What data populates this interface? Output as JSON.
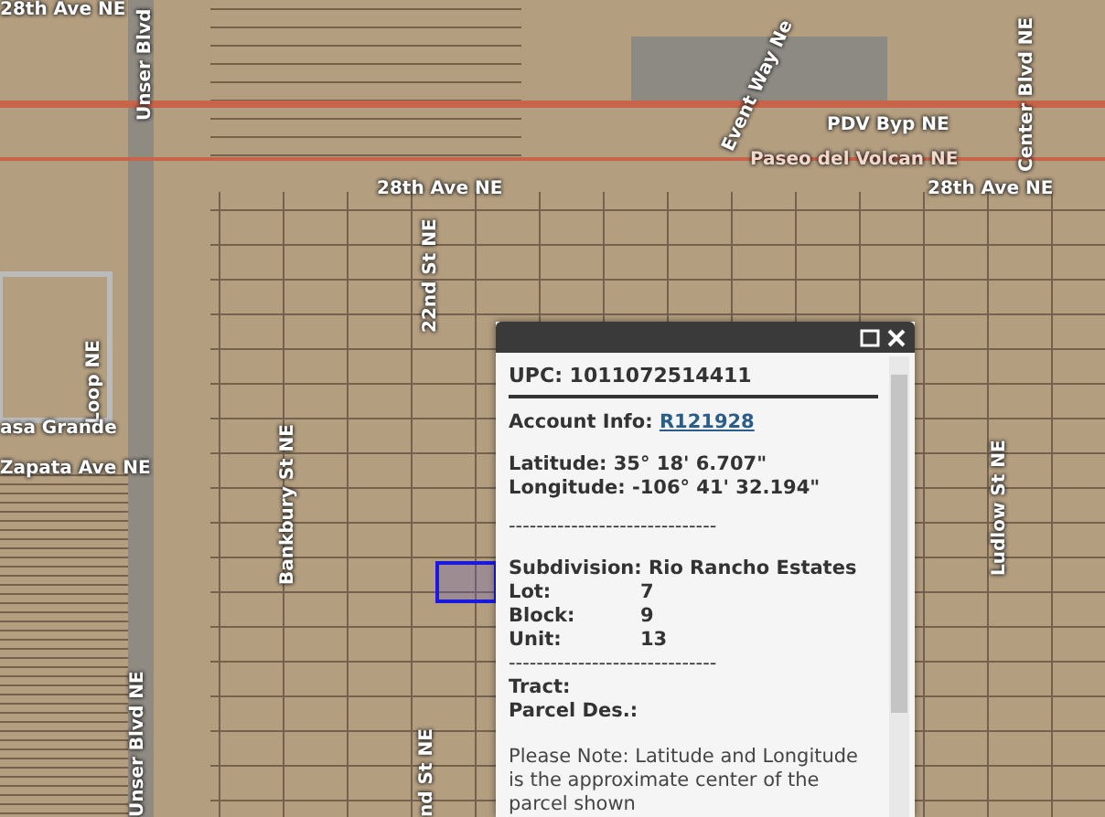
{
  "map": {
    "street_labels": [
      "28th Ave NE",
      "Unser Blvd",
      "Event Way Ne",
      "Center Blvd NE",
      "PDV Byp NE",
      "Paseo del Volcan NE",
      "28th Ave NE",
      "28th Ave NE",
      "22nd St NE",
      "Loop NE",
      "asa Grande",
      "Zapata Ave NE",
      "Bankbury St NE",
      "Unser Blvd NE",
      "nd St NE",
      "Ludlow St NE"
    ]
  },
  "popup": {
    "upc": "UPC: 1011072514411",
    "account": {
      "label": "Account Info:",
      "link": "R121928"
    },
    "coordinates": [
      "Latitude: 35° 18' 6.707\"",
      "Longitude: -106° 41' 32.194\""
    ],
    "separator_1": "------------------------------",
    "subdivision": "Subdivision: Rio Rancho Estates",
    "details": [
      {
        "label": "Lot:",
        "value": "7"
      },
      {
        "label": "Block:",
        "value": "9"
      },
      {
        "label": "Unit:",
        "value": "13"
      }
    ],
    "separator_2": "------------------------------",
    "extra": [
      "Tract:",
      "Parcel Des.:"
    ],
    "note": "Please Note: Latitude and Longitude is the approximate center of the parcel shown"
  }
}
